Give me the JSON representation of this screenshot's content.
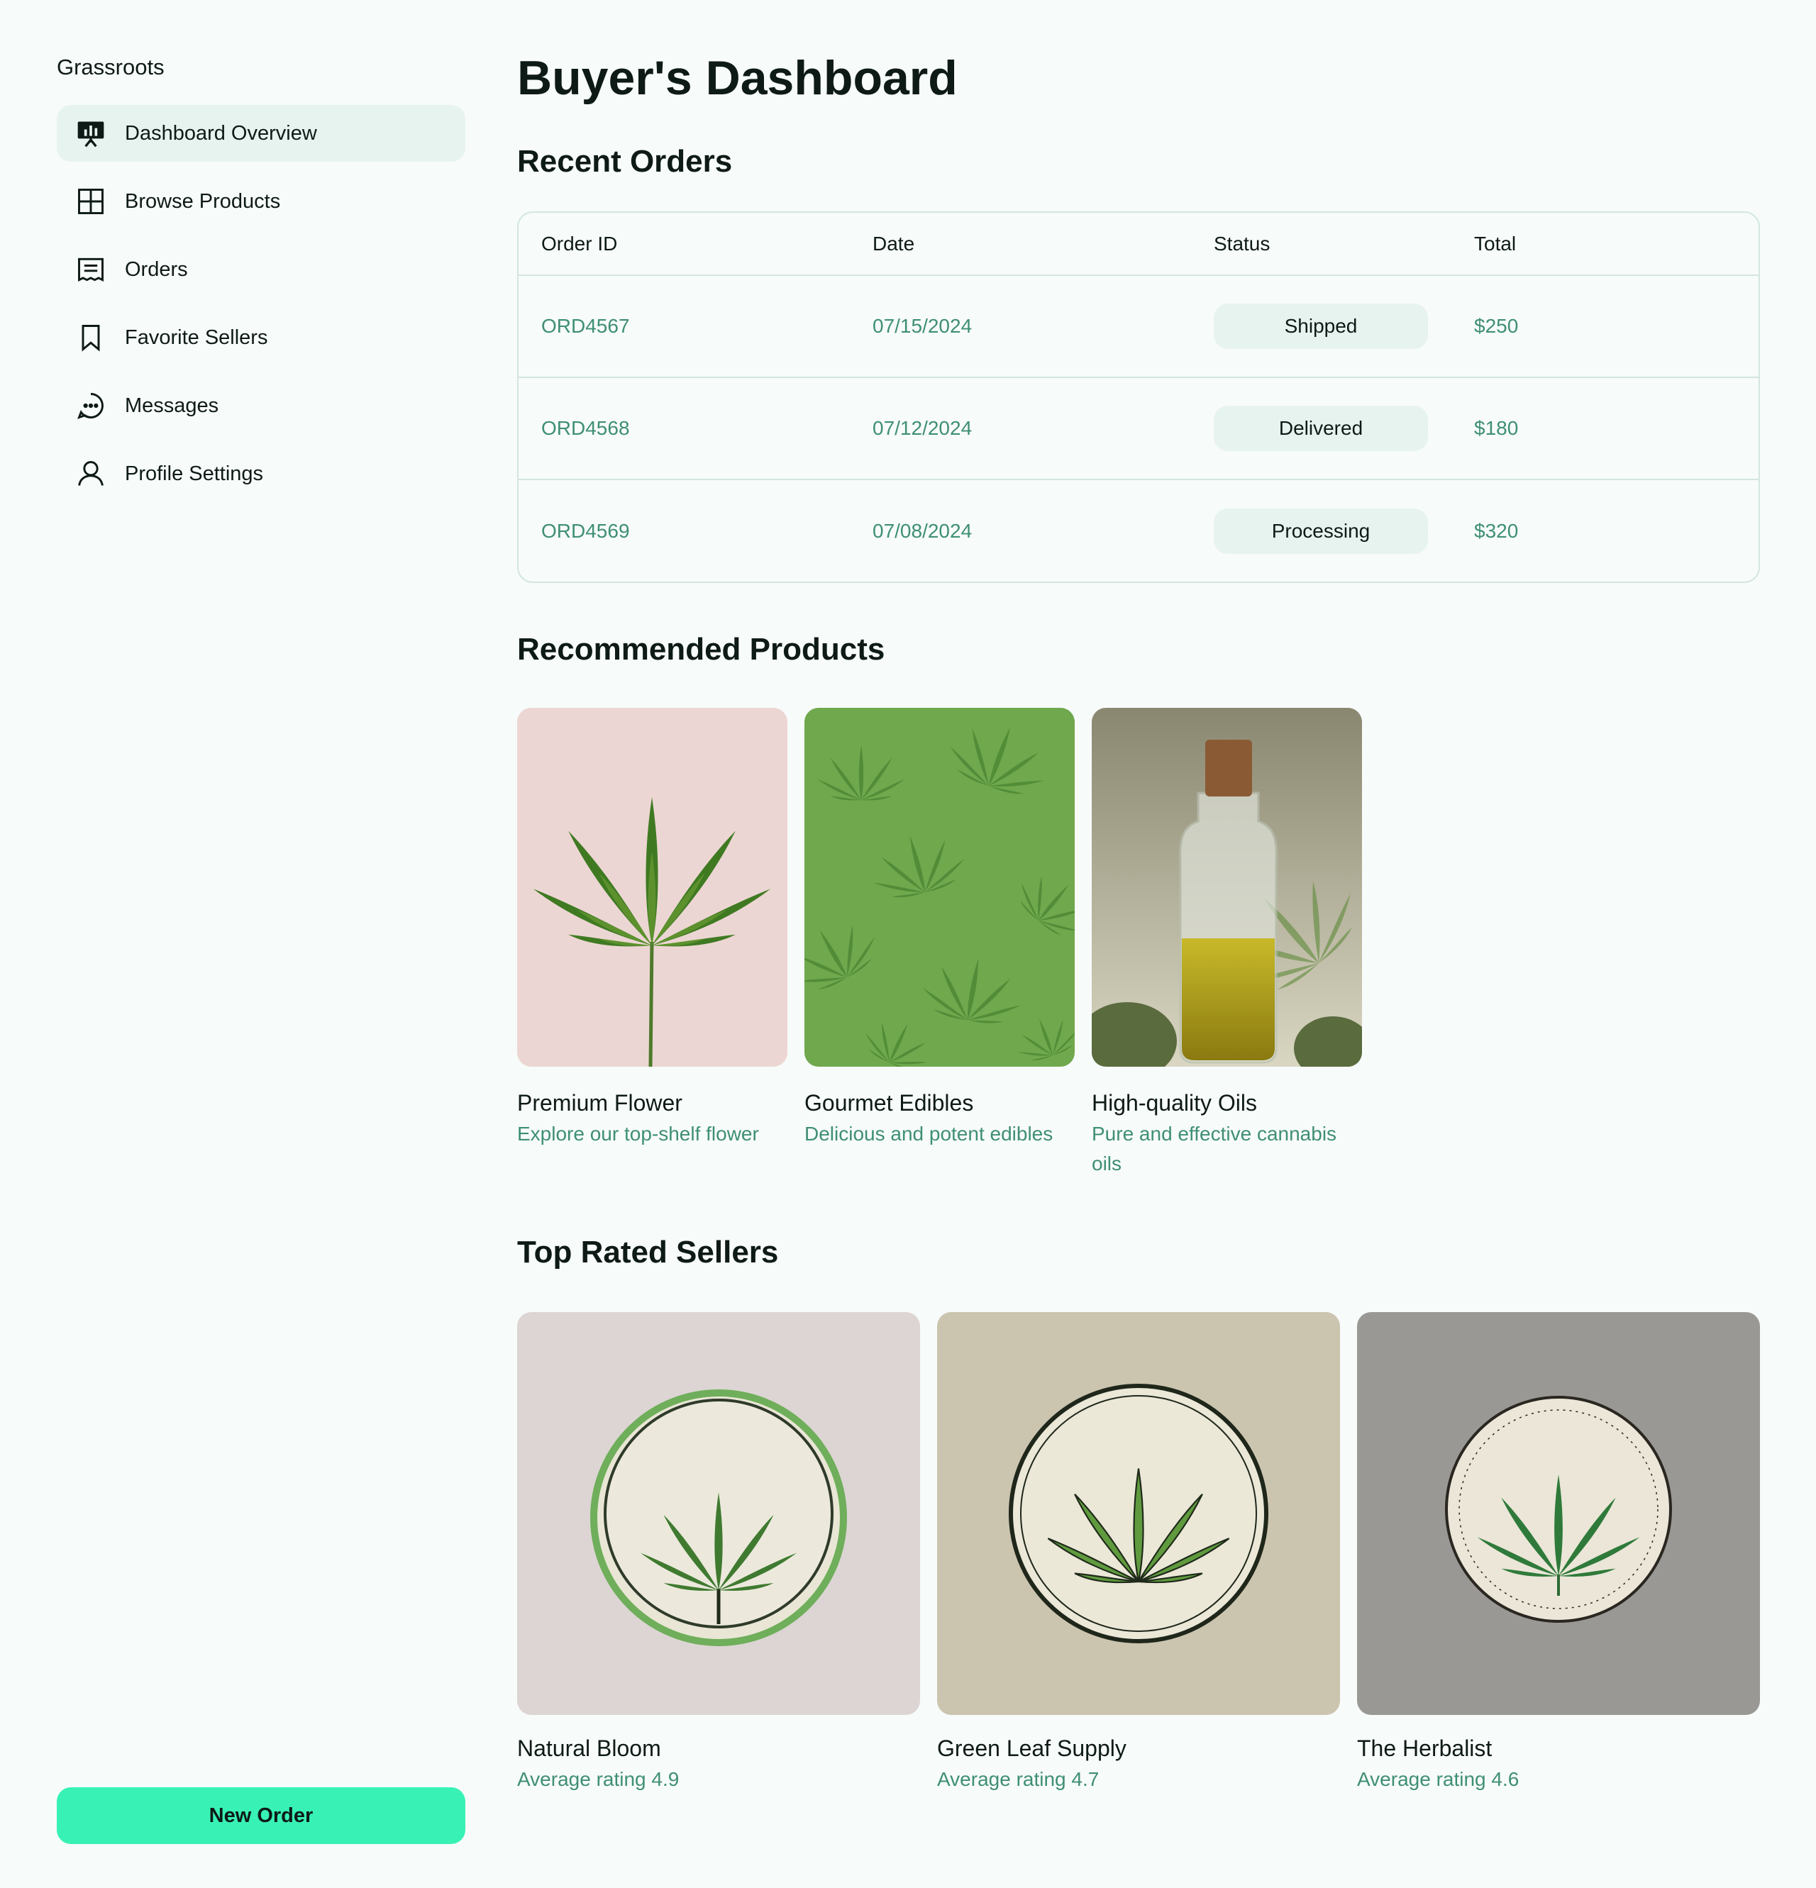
{
  "app": {
    "brand": "Grassroots"
  },
  "sidebar": {
    "items": [
      {
        "label": "Dashboard Overview",
        "icon": "presentation-chart-icon",
        "active": true
      },
      {
        "label": "Browse Products",
        "icon": "grid-icon",
        "active": false
      },
      {
        "label": "Orders",
        "icon": "receipt-icon",
        "active": false
      },
      {
        "label": "Favorite Sellers",
        "icon": "bookmark-icon",
        "active": false
      },
      {
        "label": "Messages",
        "icon": "chat-bubble-icon",
        "active": false
      },
      {
        "label": "Profile Settings",
        "icon": "user-icon",
        "active": false
      }
    ],
    "new_order_label": "New Order"
  },
  "main": {
    "title": "Buyer's Dashboard",
    "recent_orders": {
      "title": "Recent Orders",
      "columns": [
        "Order ID",
        "Date",
        "Status",
        "Total"
      ],
      "rows": [
        {
          "id": "ORD4567",
          "date": "07/15/2024",
          "status": "Shipped",
          "total": "$250"
        },
        {
          "id": "ORD4568",
          "date": "07/12/2024",
          "status": "Delivered",
          "total": "$180"
        },
        {
          "id": "ORD4569",
          "date": "07/08/2024",
          "status": "Processing",
          "total": "$320"
        }
      ]
    },
    "recommended": {
      "title": "Recommended Products",
      "items": [
        {
          "name": "Premium Flower",
          "desc": "Explore our top-shelf flower"
        },
        {
          "name": "Gourmet Edibles",
          "desc": "Delicious and potent edibles"
        },
        {
          "name": "High-quality Oils",
          "desc": "Pure and effective cannabis oils"
        }
      ]
    },
    "sellers": {
      "title": "Top Rated Sellers",
      "items": [
        {
          "name": "Natural Bloom",
          "rating": "Average rating 4.9"
        },
        {
          "name": "Green Leaf Supply",
          "rating": "Average rating 4.7"
        },
        {
          "name": "The Herbalist",
          "rating": "Average rating 4.6"
        }
      ]
    }
  },
  "colors": {
    "background": "#f7fbfa",
    "accent": "#38f2b5",
    "muted_green": "#3f8f74",
    "pill": "#e7f3ef",
    "border": "#d2e6df"
  }
}
